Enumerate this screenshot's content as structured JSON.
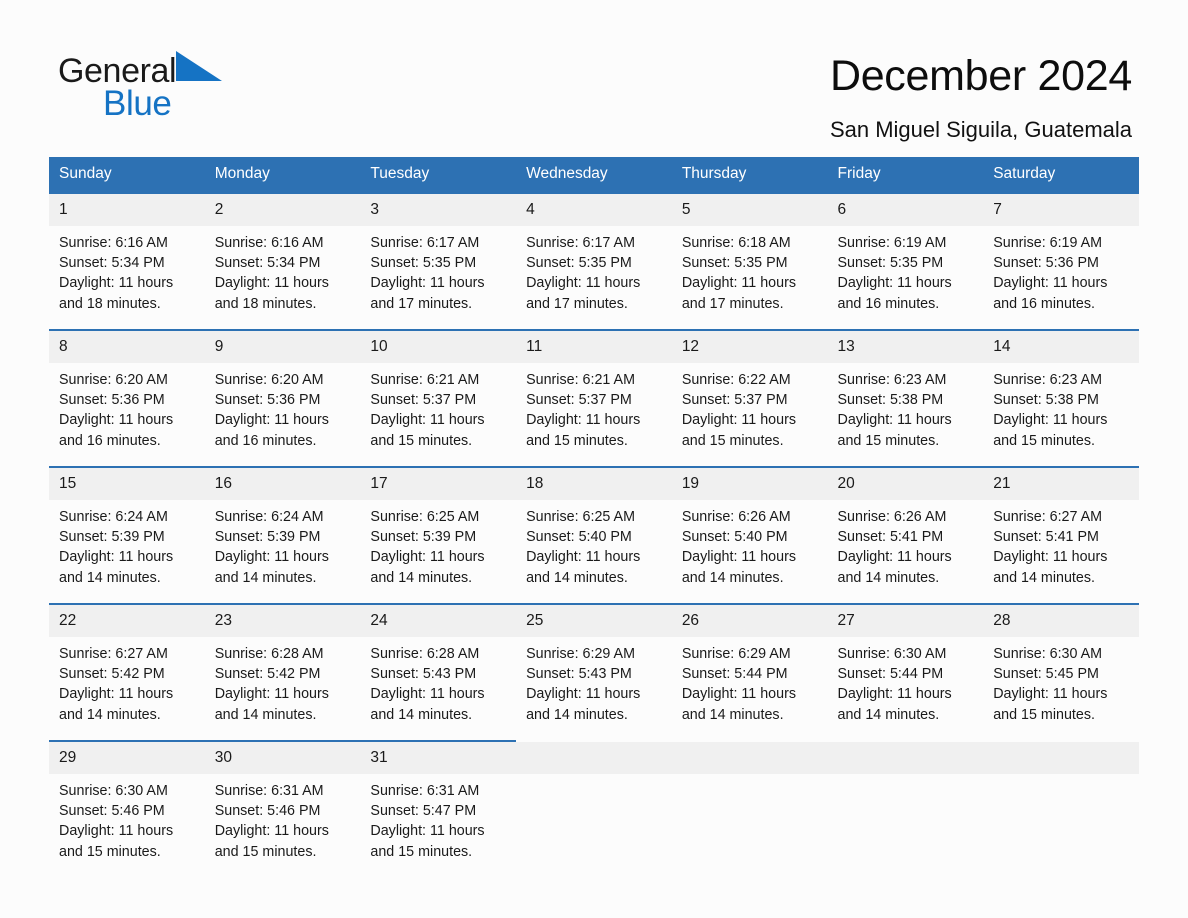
{
  "brand": {
    "name_part1": "General",
    "name_part2": "Blue",
    "triangle_color": "#1573c4",
    "logo_icon": "triangle-logo-icon"
  },
  "header": {
    "title": "December 2024",
    "subtitle": "San Miguel Siguila, Guatemala"
  },
  "theme": {
    "header_blue": "#2d71b3",
    "daynum_bg": "#f0f0f0",
    "page_bg": "#fcfcfc",
    "text": "#1a1a1a",
    "brand_blue": "#1573c4"
  },
  "calendar": {
    "weekday_headers": [
      "Sunday",
      "Monday",
      "Tuesday",
      "Wednesday",
      "Thursday",
      "Friday",
      "Saturday"
    ],
    "weeks": [
      [
        {
          "day": "1",
          "sunrise": "Sunrise: 6:16 AM",
          "sunset": "Sunset: 5:34 PM",
          "daylight": "Daylight: 11 hours and 18 minutes."
        },
        {
          "day": "2",
          "sunrise": "Sunrise: 6:16 AM",
          "sunset": "Sunset: 5:34 PM",
          "daylight": "Daylight: 11 hours and 18 minutes."
        },
        {
          "day": "3",
          "sunrise": "Sunrise: 6:17 AM",
          "sunset": "Sunset: 5:35 PM",
          "daylight": "Daylight: 11 hours and 17 minutes."
        },
        {
          "day": "4",
          "sunrise": "Sunrise: 6:17 AM",
          "sunset": "Sunset: 5:35 PM",
          "daylight": "Daylight: 11 hours and 17 minutes."
        },
        {
          "day": "5",
          "sunrise": "Sunrise: 6:18 AM",
          "sunset": "Sunset: 5:35 PM",
          "daylight": "Daylight: 11 hours and 17 minutes."
        },
        {
          "day": "6",
          "sunrise": "Sunrise: 6:19 AM",
          "sunset": "Sunset: 5:35 PM",
          "daylight": "Daylight: 11 hours and 16 minutes."
        },
        {
          "day": "7",
          "sunrise": "Sunrise: 6:19 AM",
          "sunset": "Sunset: 5:36 PM",
          "daylight": "Daylight: 11 hours and 16 minutes."
        }
      ],
      [
        {
          "day": "8",
          "sunrise": "Sunrise: 6:20 AM",
          "sunset": "Sunset: 5:36 PM",
          "daylight": "Daylight: 11 hours and 16 minutes."
        },
        {
          "day": "9",
          "sunrise": "Sunrise: 6:20 AM",
          "sunset": "Sunset: 5:36 PM",
          "daylight": "Daylight: 11 hours and 16 minutes."
        },
        {
          "day": "10",
          "sunrise": "Sunrise: 6:21 AM",
          "sunset": "Sunset: 5:37 PM",
          "daylight": "Daylight: 11 hours and 15 minutes."
        },
        {
          "day": "11",
          "sunrise": "Sunrise: 6:21 AM",
          "sunset": "Sunset: 5:37 PM",
          "daylight": "Daylight: 11 hours and 15 minutes."
        },
        {
          "day": "12",
          "sunrise": "Sunrise: 6:22 AM",
          "sunset": "Sunset: 5:37 PM",
          "daylight": "Daylight: 11 hours and 15 minutes."
        },
        {
          "day": "13",
          "sunrise": "Sunrise: 6:23 AM",
          "sunset": "Sunset: 5:38 PM",
          "daylight": "Daylight: 11 hours and 15 minutes."
        },
        {
          "day": "14",
          "sunrise": "Sunrise: 6:23 AM",
          "sunset": "Sunset: 5:38 PM",
          "daylight": "Daylight: 11 hours and 15 minutes."
        }
      ],
      [
        {
          "day": "15",
          "sunrise": "Sunrise: 6:24 AM",
          "sunset": "Sunset: 5:39 PM",
          "daylight": "Daylight: 11 hours and 14 minutes."
        },
        {
          "day": "16",
          "sunrise": "Sunrise: 6:24 AM",
          "sunset": "Sunset: 5:39 PM",
          "daylight": "Daylight: 11 hours and 14 minutes."
        },
        {
          "day": "17",
          "sunrise": "Sunrise: 6:25 AM",
          "sunset": "Sunset: 5:39 PM",
          "daylight": "Daylight: 11 hours and 14 minutes."
        },
        {
          "day": "18",
          "sunrise": "Sunrise: 6:25 AM",
          "sunset": "Sunset: 5:40 PM",
          "daylight": "Daylight: 11 hours and 14 minutes."
        },
        {
          "day": "19",
          "sunrise": "Sunrise: 6:26 AM",
          "sunset": "Sunset: 5:40 PM",
          "daylight": "Daylight: 11 hours and 14 minutes."
        },
        {
          "day": "20",
          "sunrise": "Sunrise: 6:26 AM",
          "sunset": "Sunset: 5:41 PM",
          "daylight": "Daylight: 11 hours and 14 minutes."
        },
        {
          "day": "21",
          "sunrise": "Sunrise: 6:27 AM",
          "sunset": "Sunset: 5:41 PM",
          "daylight": "Daylight: 11 hours and 14 minutes."
        }
      ],
      [
        {
          "day": "22",
          "sunrise": "Sunrise: 6:27 AM",
          "sunset": "Sunset: 5:42 PM",
          "daylight": "Daylight: 11 hours and 14 minutes."
        },
        {
          "day": "23",
          "sunrise": "Sunrise: 6:28 AM",
          "sunset": "Sunset: 5:42 PM",
          "daylight": "Daylight: 11 hours and 14 minutes."
        },
        {
          "day": "24",
          "sunrise": "Sunrise: 6:28 AM",
          "sunset": "Sunset: 5:43 PM",
          "daylight": "Daylight: 11 hours and 14 minutes."
        },
        {
          "day": "25",
          "sunrise": "Sunrise: 6:29 AM",
          "sunset": "Sunset: 5:43 PM",
          "daylight": "Daylight: 11 hours and 14 minutes."
        },
        {
          "day": "26",
          "sunrise": "Sunrise: 6:29 AM",
          "sunset": "Sunset: 5:44 PM",
          "daylight": "Daylight: 11 hours and 14 minutes."
        },
        {
          "day": "27",
          "sunrise": "Sunrise: 6:30 AM",
          "sunset": "Sunset: 5:44 PM",
          "daylight": "Daylight: 11 hours and 14 minutes."
        },
        {
          "day": "28",
          "sunrise": "Sunrise: 6:30 AM",
          "sunset": "Sunset: 5:45 PM",
          "daylight": "Daylight: 11 hours and 15 minutes."
        }
      ],
      [
        {
          "day": "29",
          "sunrise": "Sunrise: 6:30 AM",
          "sunset": "Sunset: 5:46 PM",
          "daylight": "Daylight: 11 hours and 15 minutes."
        },
        {
          "day": "30",
          "sunrise": "Sunrise: 6:31 AM",
          "sunset": "Sunset: 5:46 PM",
          "daylight": "Daylight: 11 hours and 15 minutes."
        },
        {
          "day": "31",
          "sunrise": "Sunrise: 6:31 AM",
          "sunset": "Sunset: 5:47 PM",
          "daylight": "Daylight: 11 hours and 15 minutes."
        },
        {
          "day": "",
          "sunrise": "",
          "sunset": "",
          "daylight": "",
          "empty": true
        },
        {
          "day": "",
          "sunrise": "",
          "sunset": "",
          "daylight": "",
          "empty": true
        },
        {
          "day": "",
          "sunrise": "",
          "sunset": "",
          "daylight": "",
          "empty": true
        },
        {
          "day": "",
          "sunrise": "",
          "sunset": "",
          "daylight": "",
          "empty": true
        }
      ]
    ]
  }
}
